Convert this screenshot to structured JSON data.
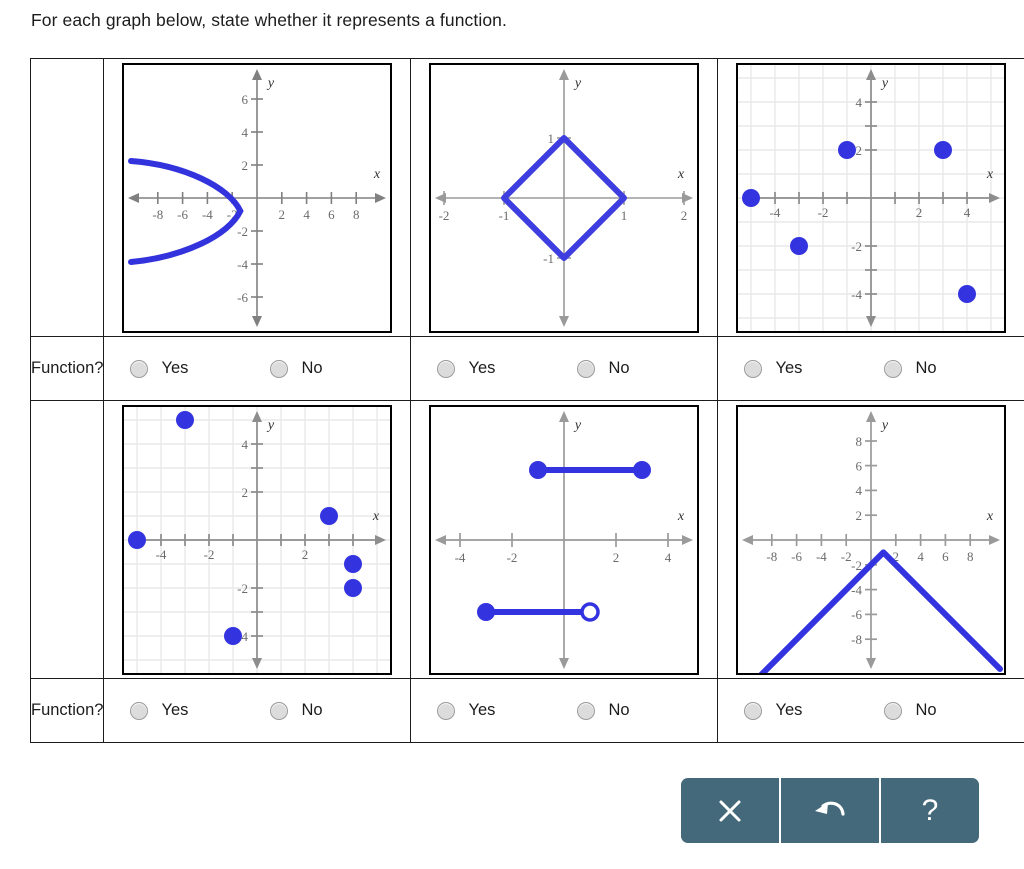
{
  "prompt": "For each graph below, state whether it represents a function.",
  "row_label": "Function?",
  "options": {
    "yes": "Yes",
    "no": "No"
  },
  "colors": {
    "curve": "#3333dd",
    "point": "#3333dd",
    "axis": "#808080",
    "grid": "#e6e6e6",
    "tick_label": "#6b6b6b",
    "toolbar": "#44697a",
    "border": "#000000"
  },
  "toolbar": {
    "buttons": [
      {
        "name": "clear-button",
        "icon": "close-icon",
        "glyph": "×"
      },
      {
        "name": "undo-button",
        "icon": "undo-arrow-icon",
        "glyph": "↶"
      },
      {
        "name": "help-button",
        "icon": "question-mark-icon",
        "glyph": "?"
      }
    ]
  },
  "chart_data": [
    {
      "id": "graph-1",
      "type": "line",
      "title": "Sideways parabola opening left",
      "xlabel": "x",
      "ylabel": "y",
      "xlim": [
        -10,
        10
      ],
      "ylim": [
        -7.5,
        7.5
      ],
      "xticks": [
        -8,
        -6,
        -4,
        -2,
        2,
        4,
        6,
        8
      ],
      "yticks": [
        -6,
        -4,
        -2,
        2,
        4,
        6
      ],
      "grid": false,
      "vertex": [
        -1.3,
        -1
      ],
      "equation": "x = -0.55*(y+1)^2 - 1.3",
      "is_function": false
    },
    {
      "id": "graph-2",
      "type": "line",
      "title": "Diamond / rhombus",
      "xlabel": "x",
      "ylabel": "y",
      "xlim": [
        -2.4,
        2.4
      ],
      "ylim": [
        -2.4,
        2.4
      ],
      "xticks": [
        -2,
        -1,
        1,
        2
      ],
      "yticks": [
        -1,
        1
      ],
      "grid": false,
      "vertices": [
        [
          0,
          1
        ],
        [
          1,
          0
        ],
        [
          0,
          -1
        ],
        [
          -1,
          0
        ]
      ],
      "closed": true,
      "is_function": false
    },
    {
      "id": "graph-3",
      "type": "scatter",
      "title": "Five scattered points",
      "xlabel": "x",
      "ylabel": "y",
      "xlim": [
        -6,
        6
      ],
      "ylim": [
        -6,
        6
      ],
      "xticks": [
        -4,
        -2,
        2,
        4
      ],
      "yticks": [
        -4,
        -2,
        2,
        4
      ],
      "grid": true,
      "points": [
        {
          "x": -5,
          "y": 0,
          "filled": true
        },
        {
          "x": -3,
          "y": -2,
          "filled": true
        },
        {
          "x": -1,
          "y": 2,
          "filled": true
        },
        {
          "x": 3,
          "y": 2,
          "filled": true
        },
        {
          "x": 4,
          "y": -4,
          "filled": true
        }
      ],
      "is_function": true
    },
    {
      "id": "graph-4",
      "type": "scatter",
      "title": "Six scattered points with two sharing x = 4",
      "xlabel": "x",
      "ylabel": "y",
      "xlim": [
        -6,
        6
      ],
      "ylim": [
        -6,
        6
      ],
      "xticks": [
        -4,
        -2,
        2
      ],
      "yticks": [
        -4,
        -2,
        2,
        4
      ],
      "grid": true,
      "points": [
        {
          "x": -5,
          "y": 0,
          "filled": true
        },
        {
          "x": -3,
          "y": 5,
          "filled": true
        },
        {
          "x": -1,
          "y": -4,
          "filled": true
        },
        {
          "x": 3,
          "y": 1,
          "filled": true
        },
        {
          "x": 4,
          "y": -1,
          "filled": true
        },
        {
          "x": 4,
          "y": -2,
          "filled": true
        }
      ],
      "is_function": false
    },
    {
      "id": "graph-5",
      "type": "line",
      "title": "Two horizontal segments",
      "xlabel": "x",
      "ylabel": "y",
      "xlim": [
        -5.5,
        5.5
      ],
      "ylim": [
        -5.5,
        5.5
      ],
      "xticks": [
        -4,
        -2,
        2,
        4
      ],
      "yticks": [],
      "grid": false,
      "segments": [
        {
          "x1": -1,
          "y1": 3,
          "x2": 3,
          "y2": 3,
          "left_endpoint": "closed",
          "right_endpoint": "closed"
        },
        {
          "x1": -3,
          "y1": -3,
          "x2": 1,
          "y2": -3,
          "left_endpoint": "closed",
          "right_endpoint": "open"
        }
      ],
      "is_function": false
    },
    {
      "id": "graph-6",
      "type": "line",
      "title": "Inverted absolute value, vertex at (1, -1)",
      "xlabel": "x",
      "ylabel": "y",
      "xlim": [
        -10,
        10
      ],
      "ylim": [
        -10,
        10
      ],
      "xticks": [
        -8,
        -6,
        -4,
        -2,
        2,
        4,
        6,
        8
      ],
      "yticks": [
        -8,
        -6,
        -4,
        -2,
        2,
        4,
        6,
        8
      ],
      "grid": false,
      "vertex": [
        1,
        -1
      ],
      "equation": "y = -|x - 1| - 1",
      "is_function": true
    }
  ]
}
